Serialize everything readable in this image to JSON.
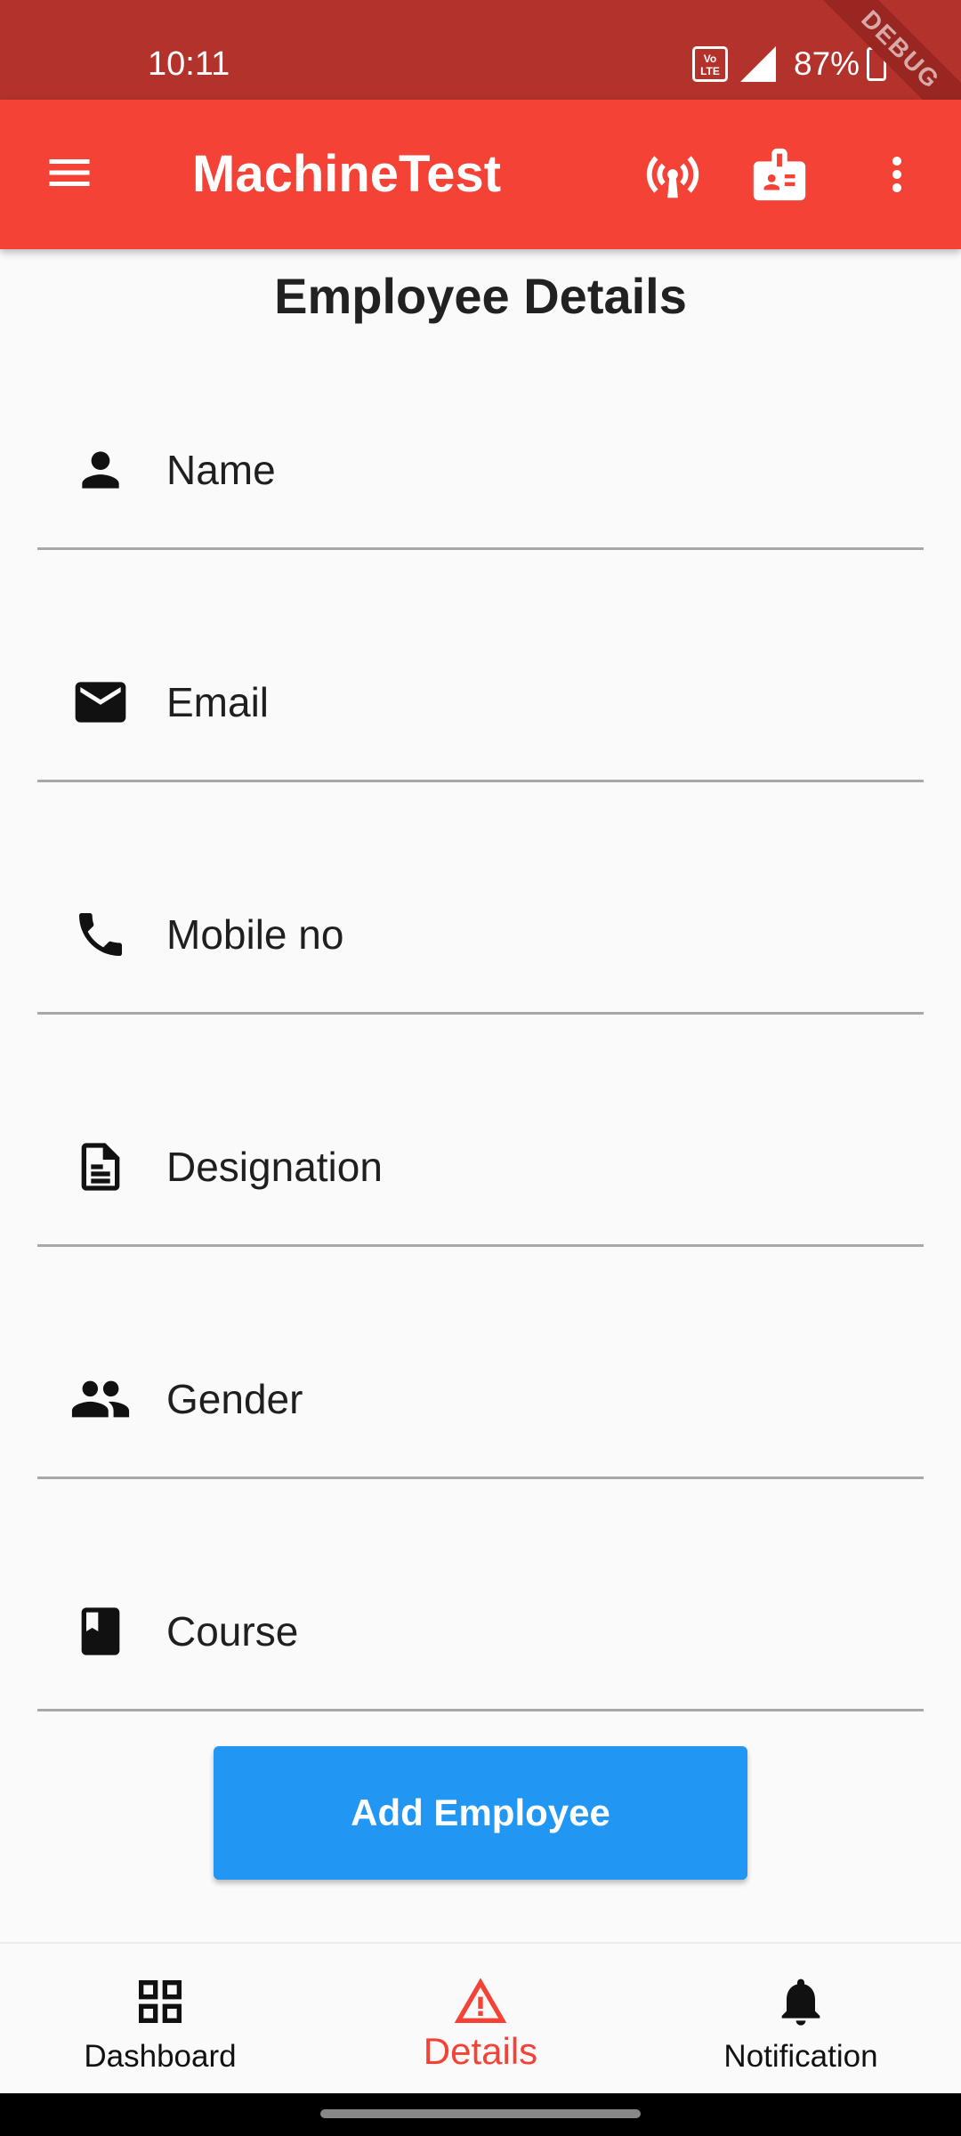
{
  "status_bar": {
    "time": "10:11",
    "network_badge": "Vo LTE",
    "battery_percent": "87%",
    "debug_banner": "DEBUG"
  },
  "app_bar": {
    "title": "MachineTest",
    "icons": [
      "menu-icon",
      "broadcast-icon",
      "badge-icon",
      "more-vert-icon"
    ],
    "background_color": "#f44336"
  },
  "page": {
    "title": "Employee Details"
  },
  "form": {
    "fields": [
      {
        "label": "Name",
        "icon": "person-icon"
      },
      {
        "label": "Email",
        "icon": "email-icon"
      },
      {
        "label": "Mobile no",
        "icon": "phone-icon"
      },
      {
        "label": "Designation",
        "icon": "document-icon"
      },
      {
        "label": "Gender",
        "icon": "people-icon"
      },
      {
        "label": "Course",
        "icon": "book-icon"
      }
    ],
    "submit_label": "Add Employee",
    "submit_color": "#2196f3"
  },
  "bottom_nav": {
    "items": [
      {
        "label": "Dashboard",
        "icon": "dashboard-icon",
        "active": false
      },
      {
        "label": "Details",
        "icon": "warning-triangle-icon",
        "active": true
      },
      {
        "label": "Notification",
        "icon": "bell-icon",
        "active": false
      }
    ],
    "active_color": "#f44336"
  }
}
